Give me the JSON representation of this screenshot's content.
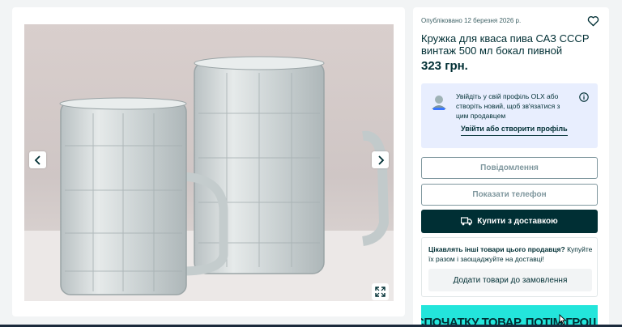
{
  "gallery": {
    "prev_icon": "chevron-left-icon",
    "next_icon": "chevron-right-icon",
    "fullscreen_icon": "expand-icon"
  },
  "listing": {
    "posted": "Опубліковано 12 березня 2026 р.",
    "title": "Кружка для кваса пива САЗ СССР винтаж 500 мл бокал пивной",
    "price": "323 грн.",
    "favorite_icon": "heart-icon"
  },
  "login_prompt": {
    "text": "Увійдіть у свій профіль OLX або створіть новий, щоб зв'язатися з цим продавцем",
    "link": "Увійти або створити профіль",
    "info_icon": "info-icon"
  },
  "actions": {
    "message": "Повідомлення",
    "phone": "Показати телефон",
    "buy": "Купити з доставкою",
    "buy_icon": "truck-icon"
  },
  "promo": {
    "bold": "Цікавлять інші товари цього продавця?",
    "rest": " Купуйте їх разом і заощаджуйте на доставці!",
    "button": "Додати товари до замовлення"
  },
  "banner": {
    "text": "СПОЧАТКУ ТОВАР, ПОТІМ ГРОШІ"
  },
  "colors": {
    "brand_dark": "#002f34",
    "banner_teal": "#23e5db",
    "login_bg": "#e8eefe",
    "disabled_border": "#7f979e"
  }
}
